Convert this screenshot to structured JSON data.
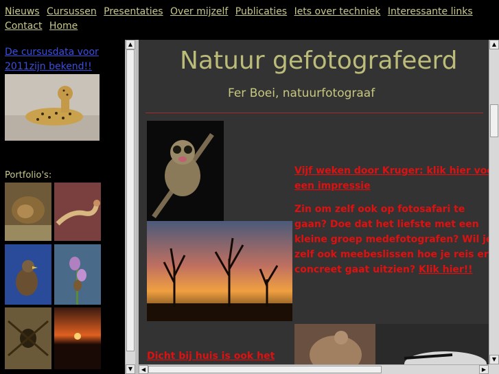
{
  "nav": {
    "items": [
      "Nieuws",
      "Cursussen",
      "Presentaties",
      "Over mijzelf",
      "Publicaties",
      "Iets over techniek",
      "Interessante links",
      "Contact",
      "Home"
    ]
  },
  "left": {
    "news_link": "De cursusdata voor 2011zijn bekend!!",
    "portfolio_label": "Portfolio's:"
  },
  "main": {
    "title": "Natuur gefotografeerd",
    "subtitle": "Fer Boei, natuurfotograaf",
    "kruger_link": "Vijf weken door Kruger: klik hier voor een impressie",
    "safari_text": "Zin om zelf ook op fotosafari te gaan? Doe dat het liefste met een kleine groep medefotografen? Wil je zelf ook meebeslissen hoe je reis er concreet gaat uitzien?",
    "safari_link": "Klik hier!!",
    "bottom_link": "Dicht bij huis is ook het"
  },
  "colors": {
    "nav_link": "#c8c88a",
    "title": "#bcbc7a",
    "accent_red": "#e01010",
    "main_bg": "#333333",
    "left_link": "#3a4fe0"
  }
}
